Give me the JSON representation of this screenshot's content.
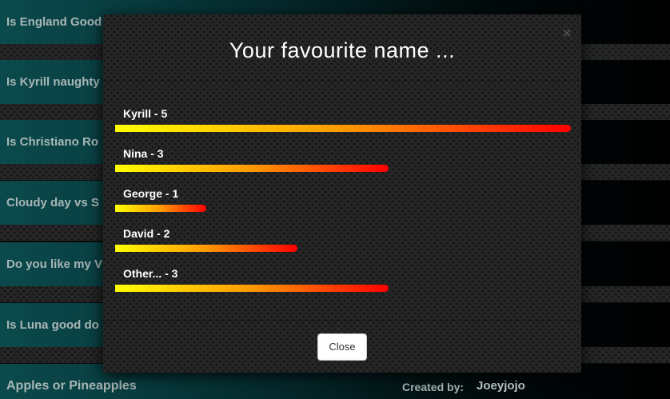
{
  "background": {
    "questions": [
      "Is England Good",
      "Is Kyrill naughty",
      "Is Christiano Ro",
      "Cloudy day vs S",
      "Do you like my V",
      "Is Luna good do"
    ],
    "footer_question": "Apples or Pineapples",
    "created_by_label": "Created by:",
    "author": "Joeyjojo"
  },
  "modal": {
    "title": "Your favourite name ...",
    "close_icon": "×",
    "close_button_label": "Close",
    "results": [
      {
        "label": "Kyrill - 5",
        "votes": 5
      },
      {
        "label": "Nina - 3",
        "votes": 3
      },
      {
        "label": "George - 1",
        "votes": 1
      },
      {
        "label": "David - 2",
        "votes": 2
      },
      {
        "label": "Other... - 3",
        "votes": 3
      }
    ],
    "max_votes": 5,
    "bar_colors": [
      "#ffff00",
      "#ff9900",
      "#ff0000"
    ]
  }
}
